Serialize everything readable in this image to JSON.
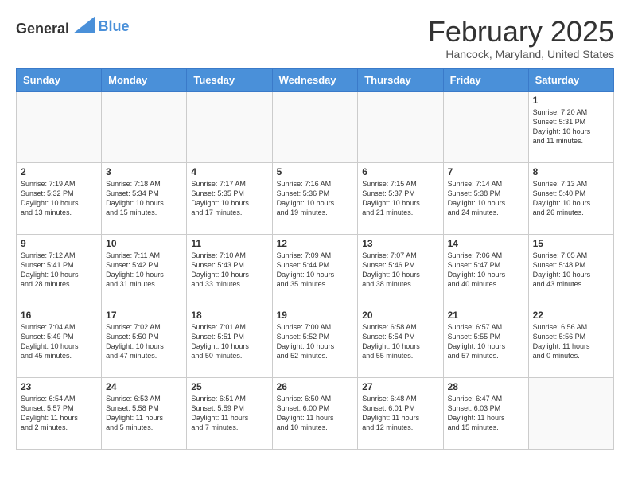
{
  "header": {
    "logo_general": "General",
    "logo_blue": "Blue",
    "month_title": "February 2025",
    "location": "Hancock, Maryland, United States"
  },
  "weekdays": [
    "Sunday",
    "Monday",
    "Tuesday",
    "Wednesday",
    "Thursday",
    "Friday",
    "Saturday"
  ],
  "weeks": [
    [
      {
        "day": "",
        "info": ""
      },
      {
        "day": "",
        "info": ""
      },
      {
        "day": "",
        "info": ""
      },
      {
        "day": "",
        "info": ""
      },
      {
        "day": "",
        "info": ""
      },
      {
        "day": "",
        "info": ""
      },
      {
        "day": "1",
        "info": "Sunrise: 7:20 AM\nSunset: 5:31 PM\nDaylight: 10 hours\nand 11 minutes."
      }
    ],
    [
      {
        "day": "2",
        "info": "Sunrise: 7:19 AM\nSunset: 5:32 PM\nDaylight: 10 hours\nand 13 minutes."
      },
      {
        "day": "3",
        "info": "Sunrise: 7:18 AM\nSunset: 5:34 PM\nDaylight: 10 hours\nand 15 minutes."
      },
      {
        "day": "4",
        "info": "Sunrise: 7:17 AM\nSunset: 5:35 PM\nDaylight: 10 hours\nand 17 minutes."
      },
      {
        "day": "5",
        "info": "Sunrise: 7:16 AM\nSunset: 5:36 PM\nDaylight: 10 hours\nand 19 minutes."
      },
      {
        "day": "6",
        "info": "Sunrise: 7:15 AM\nSunset: 5:37 PM\nDaylight: 10 hours\nand 21 minutes."
      },
      {
        "day": "7",
        "info": "Sunrise: 7:14 AM\nSunset: 5:38 PM\nDaylight: 10 hours\nand 24 minutes."
      },
      {
        "day": "8",
        "info": "Sunrise: 7:13 AM\nSunset: 5:40 PM\nDaylight: 10 hours\nand 26 minutes."
      }
    ],
    [
      {
        "day": "9",
        "info": "Sunrise: 7:12 AM\nSunset: 5:41 PM\nDaylight: 10 hours\nand 28 minutes."
      },
      {
        "day": "10",
        "info": "Sunrise: 7:11 AM\nSunset: 5:42 PM\nDaylight: 10 hours\nand 31 minutes."
      },
      {
        "day": "11",
        "info": "Sunrise: 7:10 AM\nSunset: 5:43 PM\nDaylight: 10 hours\nand 33 minutes."
      },
      {
        "day": "12",
        "info": "Sunrise: 7:09 AM\nSunset: 5:44 PM\nDaylight: 10 hours\nand 35 minutes."
      },
      {
        "day": "13",
        "info": "Sunrise: 7:07 AM\nSunset: 5:46 PM\nDaylight: 10 hours\nand 38 minutes."
      },
      {
        "day": "14",
        "info": "Sunrise: 7:06 AM\nSunset: 5:47 PM\nDaylight: 10 hours\nand 40 minutes."
      },
      {
        "day": "15",
        "info": "Sunrise: 7:05 AM\nSunset: 5:48 PM\nDaylight: 10 hours\nand 43 minutes."
      }
    ],
    [
      {
        "day": "16",
        "info": "Sunrise: 7:04 AM\nSunset: 5:49 PM\nDaylight: 10 hours\nand 45 minutes."
      },
      {
        "day": "17",
        "info": "Sunrise: 7:02 AM\nSunset: 5:50 PM\nDaylight: 10 hours\nand 47 minutes."
      },
      {
        "day": "18",
        "info": "Sunrise: 7:01 AM\nSunset: 5:51 PM\nDaylight: 10 hours\nand 50 minutes."
      },
      {
        "day": "19",
        "info": "Sunrise: 7:00 AM\nSunset: 5:52 PM\nDaylight: 10 hours\nand 52 minutes."
      },
      {
        "day": "20",
        "info": "Sunrise: 6:58 AM\nSunset: 5:54 PM\nDaylight: 10 hours\nand 55 minutes."
      },
      {
        "day": "21",
        "info": "Sunrise: 6:57 AM\nSunset: 5:55 PM\nDaylight: 10 hours\nand 57 minutes."
      },
      {
        "day": "22",
        "info": "Sunrise: 6:56 AM\nSunset: 5:56 PM\nDaylight: 11 hours\nand 0 minutes."
      }
    ],
    [
      {
        "day": "23",
        "info": "Sunrise: 6:54 AM\nSunset: 5:57 PM\nDaylight: 11 hours\nand 2 minutes."
      },
      {
        "day": "24",
        "info": "Sunrise: 6:53 AM\nSunset: 5:58 PM\nDaylight: 11 hours\nand 5 minutes."
      },
      {
        "day": "25",
        "info": "Sunrise: 6:51 AM\nSunset: 5:59 PM\nDaylight: 11 hours\nand 7 minutes."
      },
      {
        "day": "26",
        "info": "Sunrise: 6:50 AM\nSunset: 6:00 PM\nDaylight: 11 hours\nand 10 minutes."
      },
      {
        "day": "27",
        "info": "Sunrise: 6:48 AM\nSunset: 6:01 PM\nDaylight: 11 hours\nand 12 minutes."
      },
      {
        "day": "28",
        "info": "Sunrise: 6:47 AM\nSunset: 6:03 PM\nDaylight: 11 hours\nand 15 minutes."
      },
      {
        "day": "",
        "info": ""
      }
    ]
  ]
}
